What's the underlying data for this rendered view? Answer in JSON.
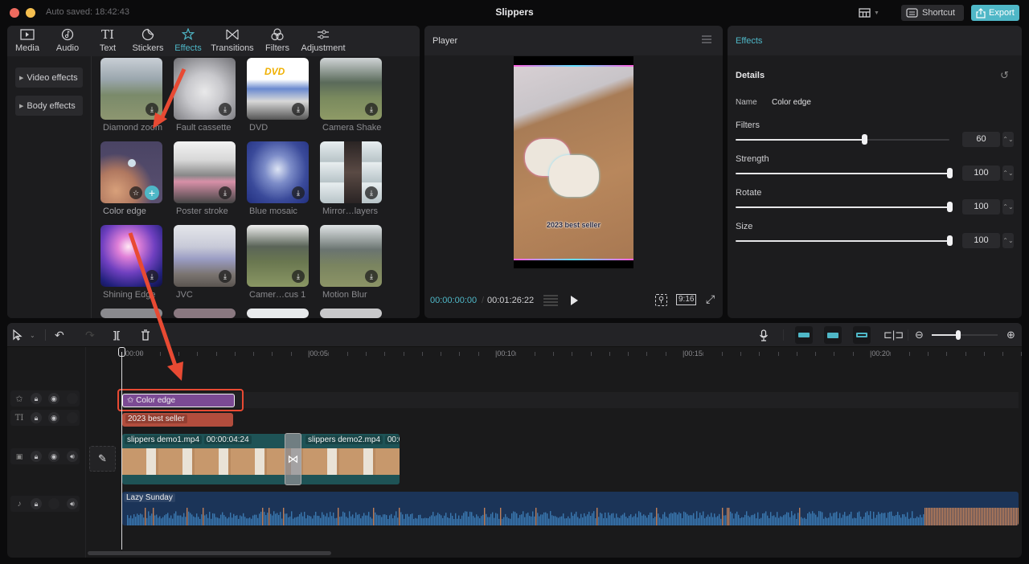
{
  "window": {
    "autosaved": "Auto saved: 18:42:43",
    "title": "Slippers",
    "shortcut_label": "Shortcut",
    "export_label": "Export",
    "accent_color": "#4fb7c7",
    "highlight_color": "#e84a33"
  },
  "media_tabs": [
    {
      "label": "Media",
      "icon": "media-icon"
    },
    {
      "label": "Audio",
      "icon": "audio-icon"
    },
    {
      "label": "Text",
      "icon": "text-icon"
    },
    {
      "label": "Stickers",
      "icon": "sticker-icon"
    },
    {
      "label": "Effects",
      "icon": "effects-icon",
      "active": true
    },
    {
      "label": "Transitions",
      "icon": "transitions-icon"
    },
    {
      "label": "Filters",
      "icon": "filters-icon"
    },
    {
      "label": "Adjustment",
      "icon": "adjustment-icon"
    }
  ],
  "effect_categories": [
    "Video effects",
    "Body effects"
  ],
  "effects": [
    {
      "label": "Diamond zoom",
      "action": "download"
    },
    {
      "label": "Fault cassette",
      "action": "download"
    },
    {
      "label": "DVD",
      "action": "download"
    },
    {
      "label": "Camera Shake",
      "action": "download"
    },
    {
      "label": "Color edge",
      "action": "add",
      "selected": true
    },
    {
      "label": "Poster stroke",
      "action": "download"
    },
    {
      "label": "Blue mosaic",
      "action": "download"
    },
    {
      "label": "Mirror…layers",
      "action": "download"
    },
    {
      "label": "Shining Edge",
      "action": "download"
    },
    {
      "label": "JVC",
      "action": "download"
    },
    {
      "label": "Camer…cus 1",
      "action": "download"
    },
    {
      "label": "Motion Blur",
      "action": "download"
    }
  ],
  "player": {
    "title": "Player",
    "current_time": "00:00:00:00",
    "separator": "/",
    "total_time": "00:01:26:22",
    "ratio": "9:16",
    "caption": "2023 best seller"
  },
  "properties": {
    "tab": "Effects",
    "section": "Details",
    "name_label": "Name",
    "name_value": "Color edge",
    "params": [
      {
        "label": "Filters",
        "value": "60",
        "fraction": 0.6
      },
      {
        "label": "Strength",
        "value": "100",
        "fraction": 1.0
      },
      {
        "label": "Rotate",
        "value": "100",
        "fraction": 1.0
      },
      {
        "label": "Size",
        "value": "100",
        "fraction": 1.0
      }
    ]
  },
  "timeline": {
    "zoom_fraction": 0.4,
    "ruler": [
      "00:00",
      "00:05",
      "00:10",
      "00:15",
      "00:20"
    ],
    "effect_clip": "Color edge",
    "text_clip": "2023 best seller",
    "video_clips": [
      {
        "name": "slippers demo1.mp4",
        "duration": "00:00:04:24"
      },
      {
        "name": "slippers demo2.mp4",
        "duration": "00:0"
      }
    ],
    "audio_clip": "Lazy Sunday"
  }
}
